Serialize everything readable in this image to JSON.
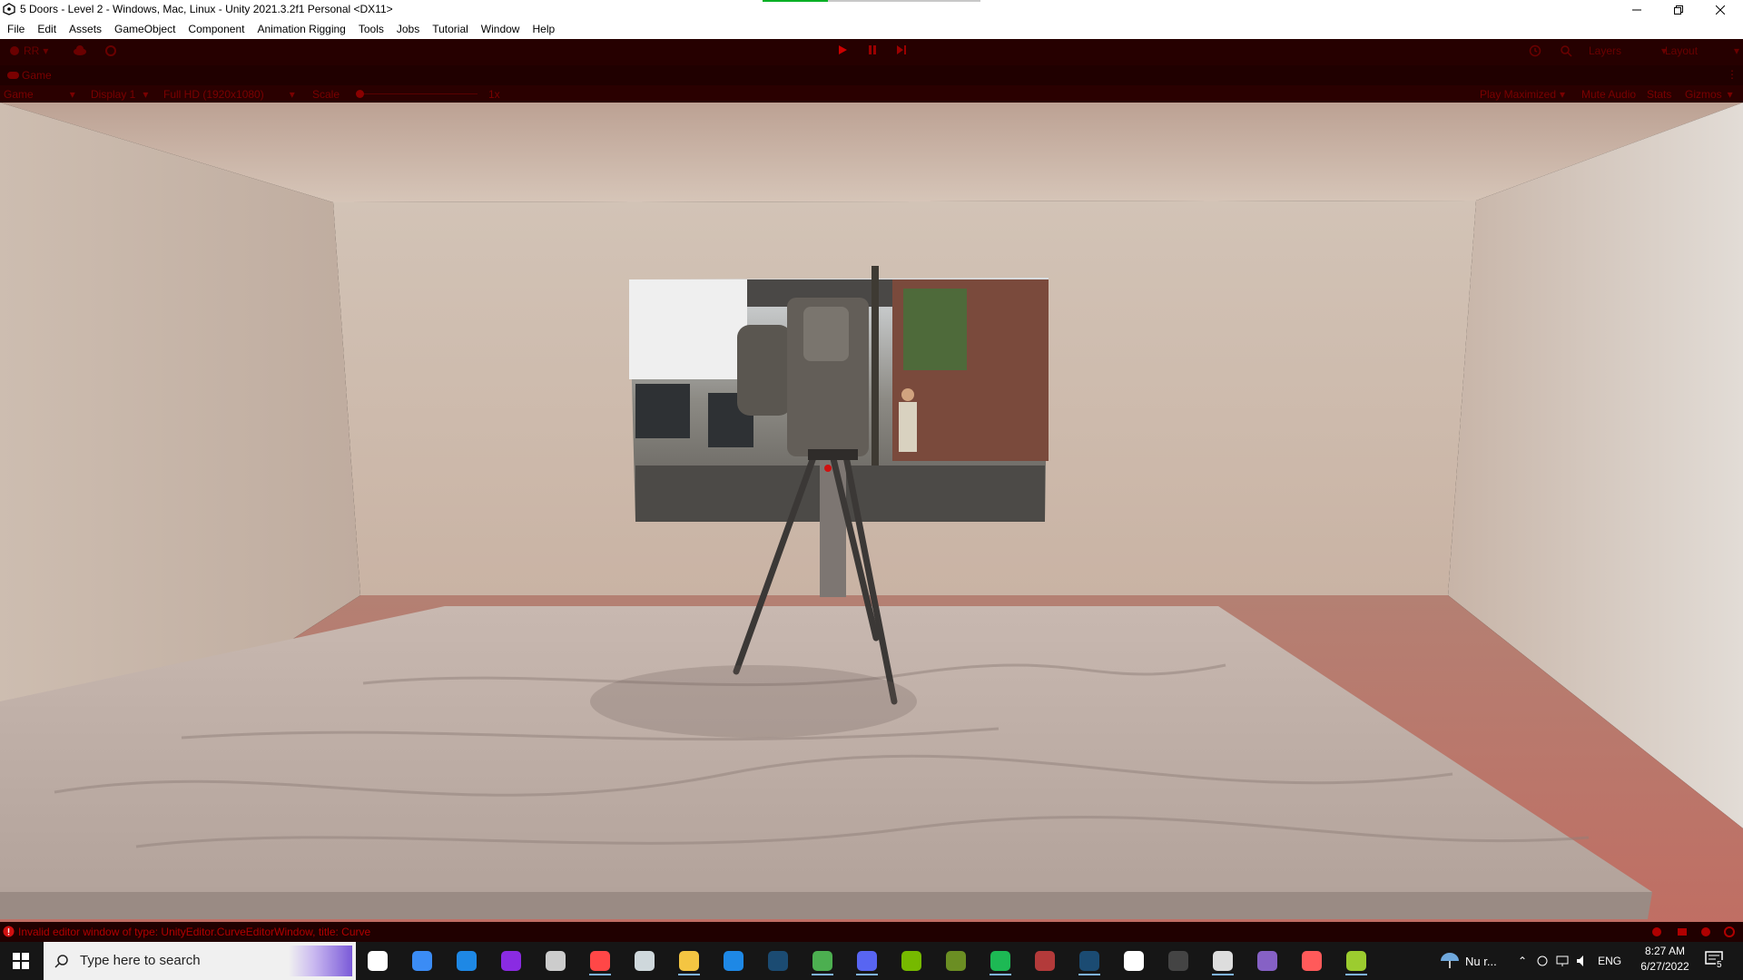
{
  "window": {
    "title": "5 Doors - Level 2 - Windows, Mac, Linux - Unity 2021.3.2f1 Personal <DX11>",
    "load_progress": 0.3
  },
  "menu": [
    "File",
    "Edit",
    "Assets",
    "GameObject",
    "Component",
    "Animation Rigging",
    "Tools",
    "Jobs",
    "Tutorial",
    "Window",
    "Help"
  ],
  "toolbar": {
    "account_label": "RR",
    "layers_label": "Layers",
    "layout_label": "Layout"
  },
  "game_tab": {
    "label": "Game"
  },
  "game_bar": {
    "mode": "Game",
    "display": "Display 1",
    "resolution": "Full HD (1920x1080)",
    "scale_label": "Scale",
    "scale_value": "1x",
    "play_maximized": "Play Maximized",
    "mute_audio": "Mute Audio",
    "stats": "Stats",
    "gizmos": "Gizmos"
  },
  "status": {
    "message": "Invalid editor window of type: UnityEditor.CurveEditorWindow, title: Curve"
  },
  "taskbar": {
    "search_placeholder": "Type here to search",
    "apps": [
      {
        "name": "task-view",
        "color": "#ffffff"
      },
      {
        "name": "todo",
        "color": "#3b8cf5"
      },
      {
        "name": "ubisoft",
        "color": "#1e88e5"
      },
      {
        "name": "cortana",
        "color": "#8a2be2"
      },
      {
        "name": "skyrim",
        "color": "#cccccc"
      },
      {
        "name": "ea",
        "color": "#ff4747"
      },
      {
        "name": "files",
        "color": "#cfd8dc"
      },
      {
        "name": "explorer",
        "color": "#f4c542"
      },
      {
        "name": "mail",
        "color": "#1e88e5"
      },
      {
        "name": "steam",
        "color": "#1b4b72"
      },
      {
        "name": "chrome",
        "color": "#4caf50"
      },
      {
        "name": "discord",
        "color": "#5865f2"
      },
      {
        "name": "nvidia",
        "color": "#76b900"
      },
      {
        "name": "minecraft",
        "color": "#6b8e23"
      },
      {
        "name": "spotify",
        "color": "#1db954"
      },
      {
        "name": "winrar",
        "color": "#b33a3a"
      },
      {
        "name": "steam-2",
        "color": "#1b4b72"
      },
      {
        "name": "notion",
        "color": "#ffffff"
      },
      {
        "name": "obs",
        "color": "#444444"
      },
      {
        "name": "unity",
        "color": "#dddddd"
      },
      {
        "name": "visual-studio",
        "color": "#8661c5"
      },
      {
        "name": "creative-cloud",
        "color": "#ff5a5a"
      },
      {
        "name": "android",
        "color": "#9ccc2f"
      }
    ],
    "weather": "Nu r...",
    "language": "ENG",
    "time": "8:27 AM",
    "date": "6/27/2022",
    "notification_count": "5"
  }
}
